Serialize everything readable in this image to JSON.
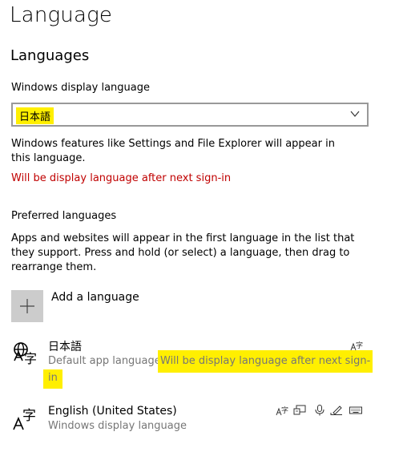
{
  "page_title": "Language",
  "section_title": "Languages",
  "display_language": {
    "label": "Windows display language",
    "selected": "日本語",
    "description": "Windows features like Settings and File Explorer will appear in this language.",
    "warning": "Will be display language after next sign-in"
  },
  "preferred": {
    "label": "Preferred languages",
    "description": "Apps and websites will appear in the first language in the list that they support. Press and hold (or select) a language, then drag to rearrange them.",
    "add_label": "Add a language",
    "languages": [
      {
        "name": "日本語",
        "status_prefix": "Default app language, ",
        "status_highlight_1": "Will be display language after next sign-",
        "status_highlight_2": "in",
        "features": [
          "language-pack-icon"
        ]
      },
      {
        "name": "English (United States)",
        "status": "Windows display language",
        "features": [
          "language-pack-icon",
          "text-to-speech-icon",
          "speech-recognition-icon",
          "handwriting-icon",
          "keyboard-icon"
        ]
      }
    ]
  },
  "colors": {
    "highlight": "#ffef00",
    "warning": "#c00000",
    "secondary_text": "#767676",
    "add_tile": "#cccccc"
  }
}
